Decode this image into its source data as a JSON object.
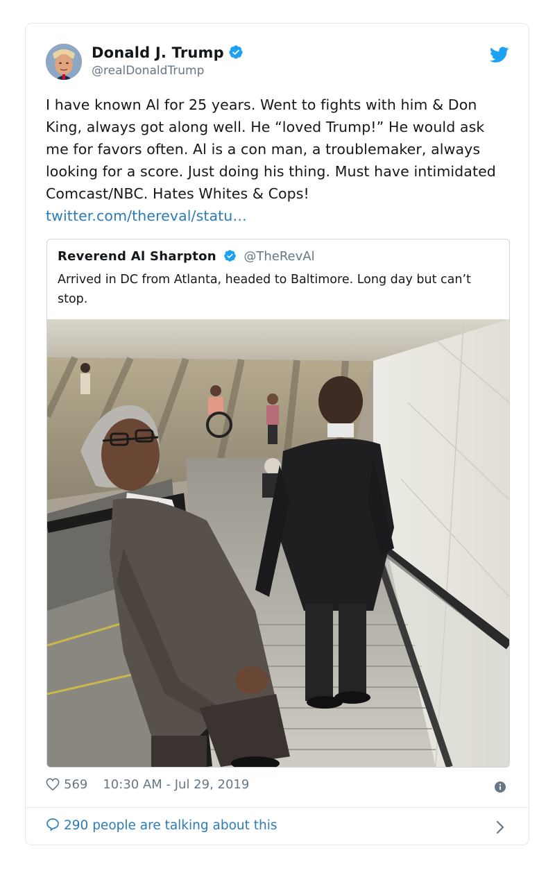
{
  "author": {
    "name": "Donald J. Trump",
    "handle": "@realDonaldTrump"
  },
  "tweet": {
    "text": "I have known Al for 25 years. Went to fights with him & Don King, always got along well. He “loved Trump!” He would ask me for favors often. Al is a con man, a troublemaker, always looking for a score. Just doing his thing. Must have intimidated Comcast/NBC. Hates Whites & Cops! ",
    "link": "twitter.com/thereval/statu…"
  },
  "quoted": {
    "name": "Reverend Al Sharpton",
    "handle": "@TheRevAl",
    "text": "Arrived in DC from Atlanta, headed to Baltimore. Long day but can’t stop."
  },
  "meta": {
    "likes": "569",
    "timestamp": "10:30 AM - Jul 29, 2019"
  },
  "footer": {
    "talking": "290 people are talking about this"
  },
  "icons": {
    "verified": "verified-badge-icon",
    "twitter": "twitter-bird-icon",
    "heart": "heart-icon",
    "info": "info-icon",
    "bubble": "speech-bubble-icon",
    "chevron": "chevron-right-icon"
  },
  "colors": {
    "accent": "#1da1f2",
    "link": "#2b7bb9",
    "text": "#14171a",
    "muted": "#657786",
    "border": "#e1e8ed"
  }
}
